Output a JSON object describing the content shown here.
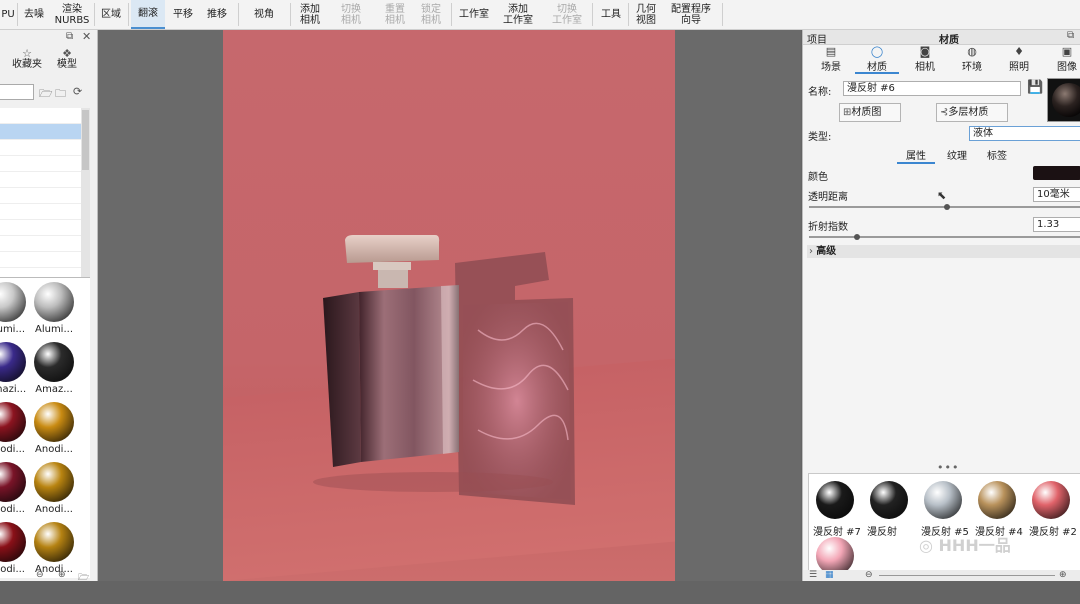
{
  "toolbar": {
    "items": [
      {
        "label": "PU"
      },
      {
        "label": "去噪"
      },
      {
        "label": "渲染\nNURBS"
      },
      {
        "label": "区域"
      },
      {
        "label": "翻滚"
      },
      {
        "label": "平移"
      },
      {
        "label": "推移"
      },
      {
        "label": "视角"
      },
      {
        "label": "添加\n相机"
      },
      {
        "label": "切换\n相机"
      },
      {
        "label": "重置\n相机"
      },
      {
        "label": "锁定\n相机"
      },
      {
        "label": "工作室"
      },
      {
        "label": "添加\n工作室"
      },
      {
        "label": "切换\n工作室"
      },
      {
        "label": "工具"
      },
      {
        "label": "几何\n视图"
      },
      {
        "label": "配置程序\n向导"
      }
    ],
    "active_item": "翻滚"
  },
  "left_panel": {
    "tabs": [
      {
        "label": "收藏夹",
        "icon": "star-icon"
      },
      {
        "label": "模型",
        "icon": "models-icon"
      }
    ],
    "materials": [
      {
        "label": "Alumi...",
        "color": "#c9c9c9"
      },
      {
        "label": "Alumi...",
        "color": "#bdbdbd"
      },
      {
        "label": "Amazi...",
        "color": "#3a2a8a"
      },
      {
        "label": "Amaz...",
        "color": "#2b2b2b"
      },
      {
        "label": "Anodi...",
        "color": "#8c1420"
      },
      {
        "label": "Anodi...",
        "color": "#c98b12"
      },
      {
        "label": "Anodi...",
        "color": "#7a1428"
      },
      {
        "label": "Anodi...",
        "color": "#b98410"
      },
      {
        "label": "Anodi...",
        "color": "#8a1018"
      },
      {
        "label": "Anodi...",
        "color": "#b58212"
      }
    ]
  },
  "right_panel": {
    "header": {
      "left": "项目",
      "title": "材质"
    },
    "tabs": [
      {
        "label": "场景",
        "icon": "scene-icon"
      },
      {
        "label": "材质",
        "icon": "material-icon"
      },
      {
        "label": "相机",
        "icon": "camera-icon"
      },
      {
        "label": "环境",
        "icon": "environment-icon"
      },
      {
        "label": "照明",
        "icon": "lighting-icon"
      },
      {
        "label": "图像",
        "icon": "image-icon"
      }
    ],
    "active_tab": "材质",
    "name_label": "名称:",
    "name_value": "漫反射 #6",
    "material_graph_button": "材质图",
    "multi_layer_button": "多层材质",
    "type_label": "类型:",
    "type_value": "液体",
    "subtabs": [
      {
        "label": "属性"
      },
      {
        "label": "纹理"
      },
      {
        "label": "标签"
      }
    ],
    "active_subtab": "属性",
    "color_label": "颜色",
    "color_value": "#1b1113",
    "transparency_label": "透明距离",
    "transparency_value": "10毫米",
    "ior_label": "折射指数",
    "ior_value": "1.33",
    "advanced_label": "高级",
    "tray_materials": [
      {
        "label": "漫反射 #7",
        "color": "#1a1a1a"
      },
      {
        "label": "漫反射",
        "color": "#222222"
      },
      {
        "label": "漫反射 #5",
        "color": "#b8c0c8"
      },
      {
        "label": "漫反射 #4",
        "color": "#b9925c"
      },
      {
        "label": "漫反射 #2",
        "color": "#e0636a"
      },
      {
        "label": "",
        "color": "#f3a6b6"
      }
    ]
  },
  "watermark": "一品"
}
